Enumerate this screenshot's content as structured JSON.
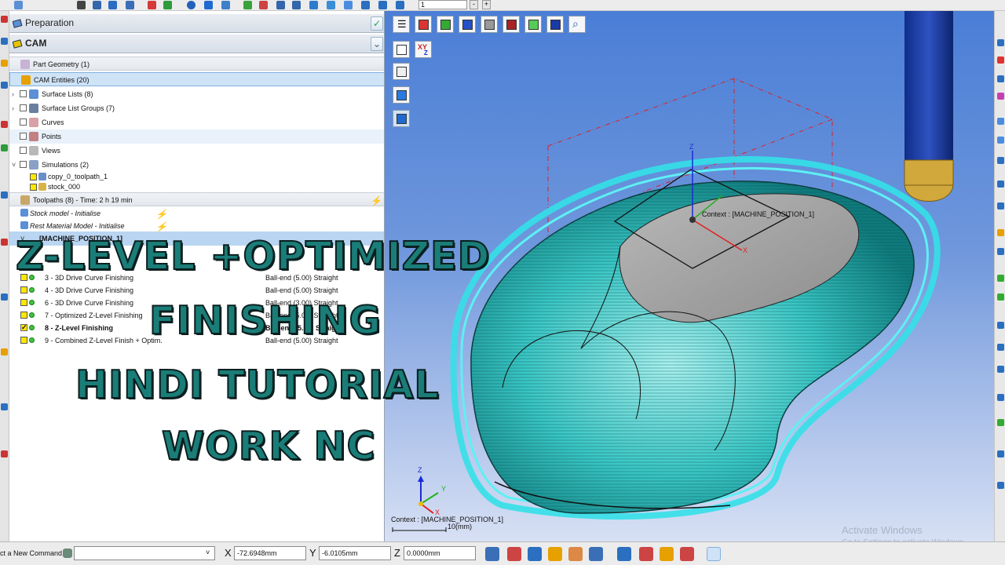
{
  "toolbar": {
    "zoom_value": "1",
    "minus": "-",
    "plus": "+"
  },
  "panel": {
    "preparation_label": "Preparation",
    "cam_label": "CAM"
  },
  "tree": {
    "part_geometry": "Part Geometry (1)",
    "cam_entities": "CAM Entities (20)",
    "surface_lists": "Surface Lists (8)",
    "surface_list_groups": "Surface List Groups (7)",
    "curves": "Curves",
    "points": "Points",
    "views": "Views",
    "simulations": "Simulations (2)",
    "sim_1": "copy_0_toolpath_1",
    "sim_2": "stock_000",
    "toolpaths": "Toolpaths (8) - Time: 2 h 19 min",
    "stock_model": "Stock model - Initialise",
    "rest_material": "Rest Material Model - Initialise",
    "machine_position": "[MACHINE_POSITION_1]",
    "toolpath_items": [
      {
        "label": "3 - 3D Drive Curve Finishing",
        "tool": "Ball-end (5.00) Straight",
        "checked": false
      },
      {
        "label": "4 - 3D Drive Curve Finishing",
        "tool": "Ball-end (5.00) Straight",
        "checked": false
      },
      {
        "label": "6 - 3D Drive Curve Finishing",
        "tool": "Ball-end (3.00) Straight",
        "checked": false
      },
      {
        "label": "7 - Optimized Z-Level Finishing",
        "tool": "Ball-end (5.00) Straight",
        "checked": false
      },
      {
        "label": "8 - Z-Level Finishing",
        "tool": "Ball-end (5.00) Straight",
        "checked": true
      },
      {
        "label": "9 - Combined Z-Level Finish + Optim.",
        "tool": "Ball-end (5.00) Straight",
        "checked": false
      }
    ]
  },
  "overlay": {
    "line1": "Z-LEVEL +OPTIMIZED",
    "line2": "FINISHING",
    "line3": "HINDI TUTORIAL",
    "line4": "WORK NC"
  },
  "viewport": {
    "context_label": "Context : [MACHINE_POSITION_1]",
    "context_label_bottom": "Context : [MACHINE_POSITION_1]",
    "scale_label": "10(mm)",
    "axis_z": "Z",
    "axis_x": "X",
    "axis_y": "Y"
  },
  "statusbar": {
    "command_label": "ct a New Command...",
    "command_value": "",
    "x_label": "X",
    "x_value": "-72.6948mm",
    "y_label": "Y",
    "y_value": "-6.0105mm",
    "z_label": "Z",
    "z_value": "0.0000mm"
  },
  "watermark": {
    "line1": "Activate Windows",
    "line2": "Go to Settings to activate Windows."
  },
  "colors": {
    "accent": "#cfe3f7",
    "toolpath": "#34e0e8",
    "overlay_text": "#1a7d78",
    "background_top": "#4a7ed6"
  }
}
